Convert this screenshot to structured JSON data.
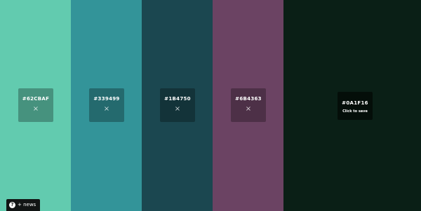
{
  "palette": {
    "swatches": [
      {
        "color": "#62CBAF",
        "hex_label": "#62CBAF",
        "remove_icon": "×"
      },
      {
        "color": "#339499",
        "hex_label": "#339499",
        "remove_icon": "×"
      },
      {
        "color": "#1B4750",
        "hex_label": "#1B4750",
        "remove_icon": "×"
      },
      {
        "color": "#6B4363",
        "hex_label": "#6B4363",
        "remove_icon": "×"
      },
      {
        "color": "#0A1F16",
        "hex_label": "#0A1F16",
        "save_label": "Click to save"
      }
    ]
  },
  "news_button": {
    "icon": "?",
    "label": "+ news"
  }
}
